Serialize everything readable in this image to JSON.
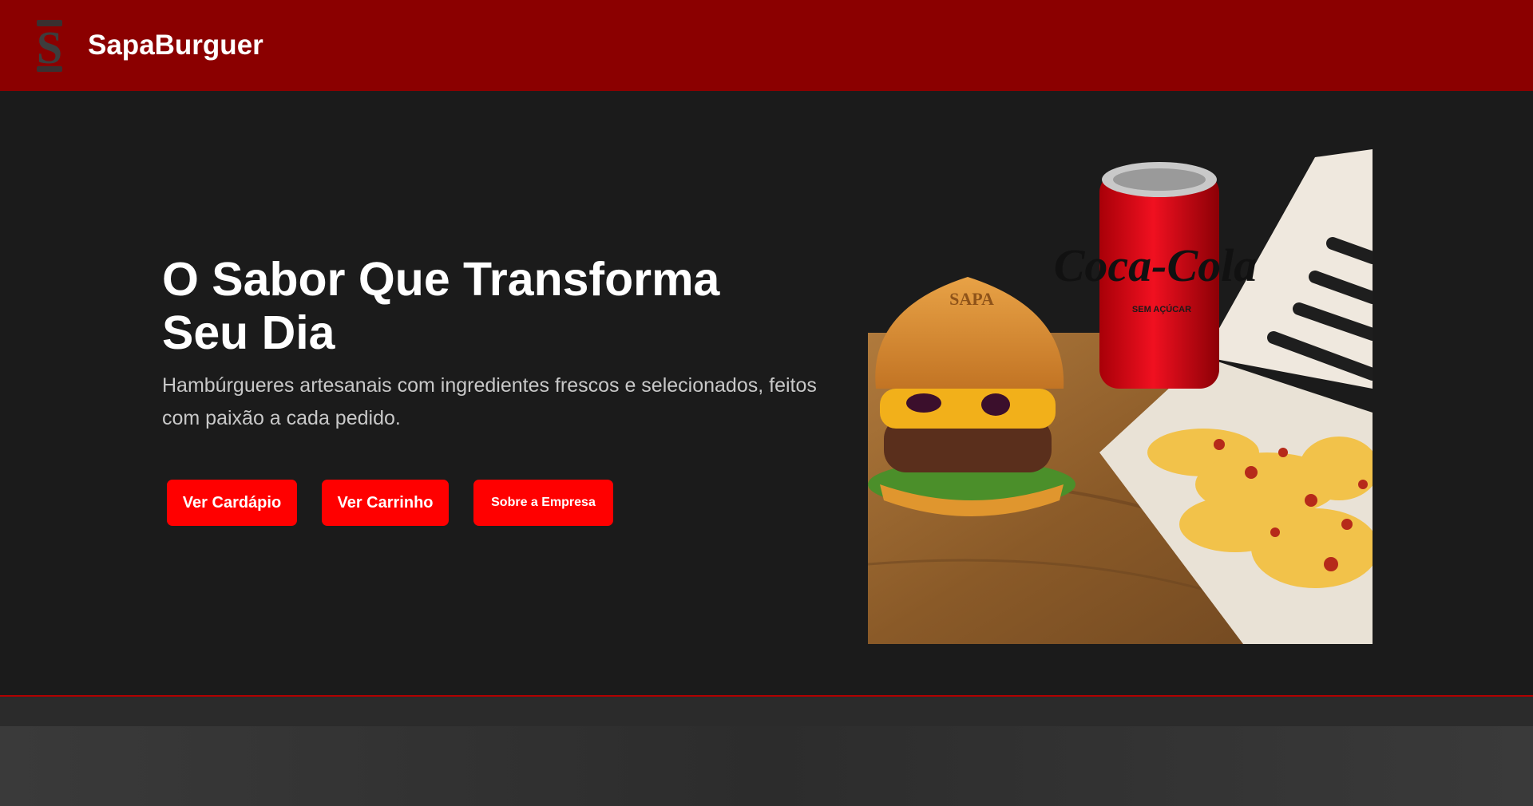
{
  "header": {
    "brand": "SapaBurguer",
    "logo_icon": "sapa-logo-icon",
    "background_color": "#8b0000"
  },
  "hero": {
    "title_line1": "O Sabor Que Transforma",
    "title_line2": "Seu Dia",
    "subtitle": "Hambúrgueres artesanais com ingredientes frescos e selecionados, feitos com paixão a cada pedido.",
    "buttons": {
      "menu": "Ver Cardápio",
      "cart": "Ver Carrinho",
      "about": "Sobre a Empresa"
    },
    "button_color": "#ff0000",
    "image": "burger-soda-fries-photo",
    "can_text": "Coca-Cola",
    "can_subtext": "SEM AÇÚCAR"
  }
}
